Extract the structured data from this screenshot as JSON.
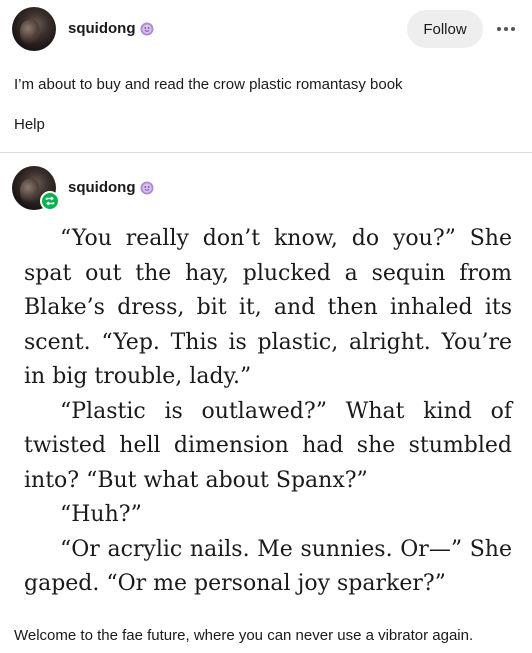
{
  "post": {
    "username": "squidong",
    "follow_label": "Follow",
    "text_lines": [
      "I’m about to buy and read the crow plastic romantasy book",
      "Help"
    ]
  },
  "reblog": {
    "username": "squidong",
    "excerpt": [
      "“You really don’t know, do you?” She spat out the hay, plucked a sequin from Blake’s dress, bit it, and then inhaled its scent. “Yep. This is plastic, alright. You’re in big trouble, lady.”",
      "“Plastic is outlawed?” What kind of twisted hell dimension had she stumbled into? “But what about Spanx?”",
      "“Huh?”",
      "“Or acrylic nails. Me sunnies. Or—” She gaped. “Or me personal joy sparker?”"
    ],
    "caption": "Welcome to the fae future, where you can never use a vibrator again."
  },
  "colors": {
    "follow_bg": "#eeeeee",
    "reblog_badge": "#00b84a",
    "user_badge": "#b08ad8"
  },
  "icons": {
    "avatar": "avatar",
    "user_badge": "purple-smiley-badge-icon",
    "reblog": "reblog-icon",
    "more": "more-icon"
  }
}
